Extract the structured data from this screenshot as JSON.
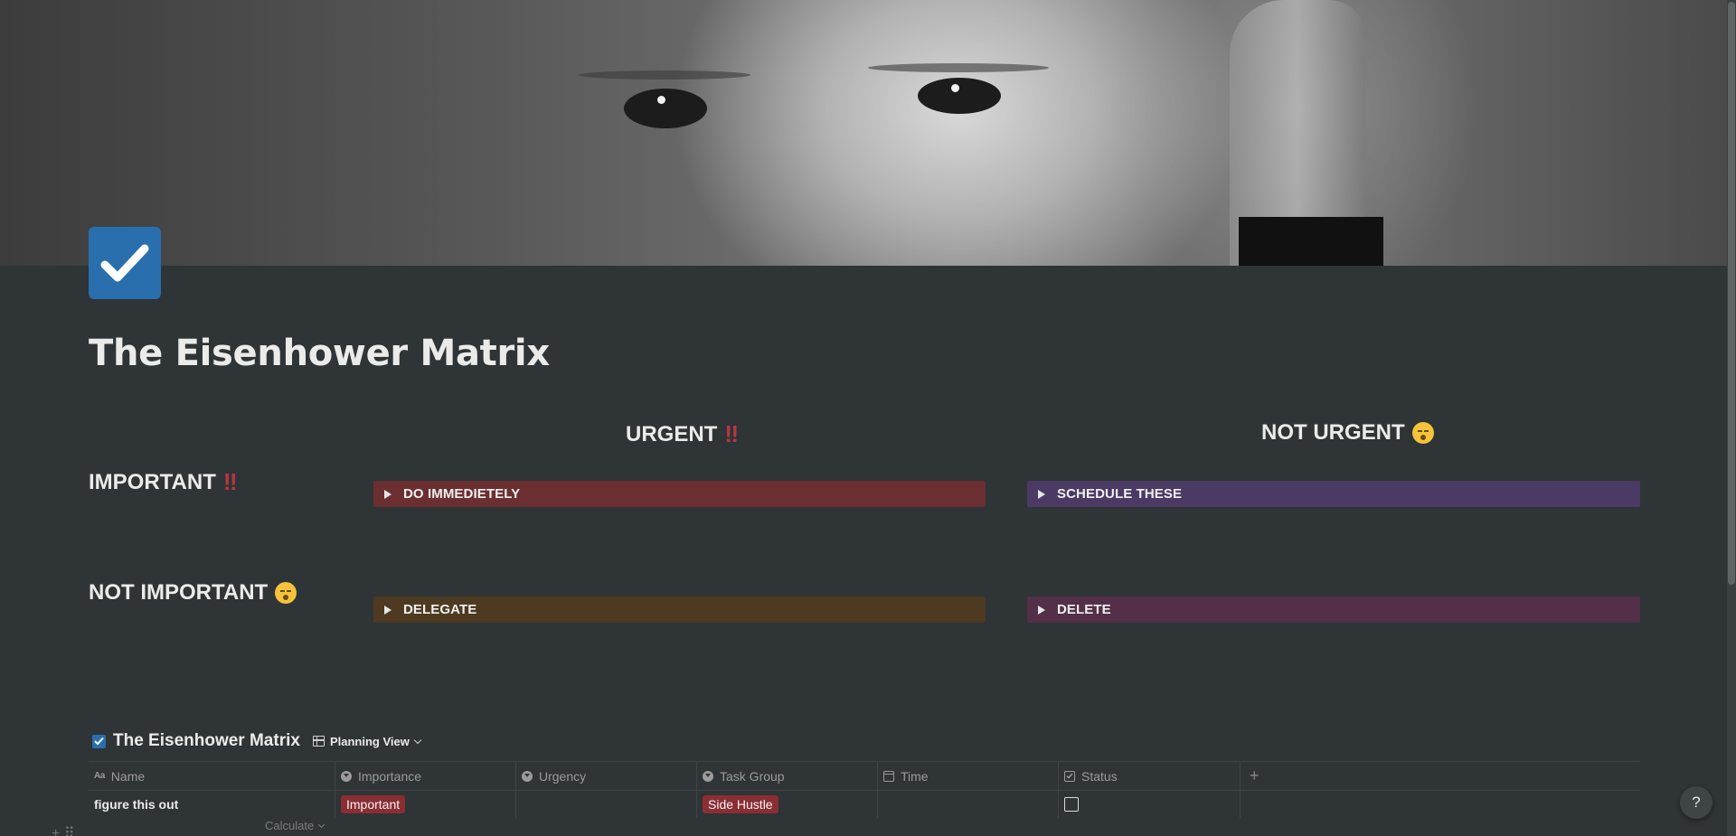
{
  "page": {
    "title": "The Eisenhower Matrix",
    "icon": "checkbox-icon"
  },
  "matrix": {
    "col_urgent": "URGENT",
    "col_not_urgent": "NOT URGENT",
    "row_important": "IMPORTANT",
    "row_not_important": "NOT IMPORTANT",
    "urgent_marker": "‼",
    "important_marker": "‼",
    "toggles": {
      "do": {
        "label": "DO IMMEDIETELY",
        "color": "#6b2f32"
      },
      "schedule": {
        "label": "SCHEDULE THESE",
        "color": "#4b3a63"
      },
      "delegate": {
        "label": "DELEGATE",
        "color": "#4d3a20"
      },
      "delete": {
        "label": "DELETE",
        "color": "#532f48"
      }
    }
  },
  "database": {
    "title": "The Eisenhower Matrix",
    "view": "Planning View",
    "columns": [
      {
        "label": "Name",
        "icon": "text-icon"
      },
      {
        "label": "Importance",
        "icon": "select-icon"
      },
      {
        "label": "Urgency",
        "icon": "select-icon"
      },
      {
        "label": "Task Group",
        "icon": "select-icon"
      },
      {
        "label": "Time",
        "icon": "calendar-icon"
      },
      {
        "label": "Status",
        "icon": "checkbox-icon"
      }
    ],
    "add_column": "+",
    "rows": [
      {
        "name": "figure this out",
        "importance": "Important",
        "urgency": "",
        "task_group": "Side Hustle",
        "time": "",
        "status": false
      }
    ],
    "calculate": "Calculate"
  },
  "help": "?",
  "colors": {
    "background": "#2f3437",
    "accent_blue": "#2a6fad",
    "tag_red": "#8a2e33"
  }
}
